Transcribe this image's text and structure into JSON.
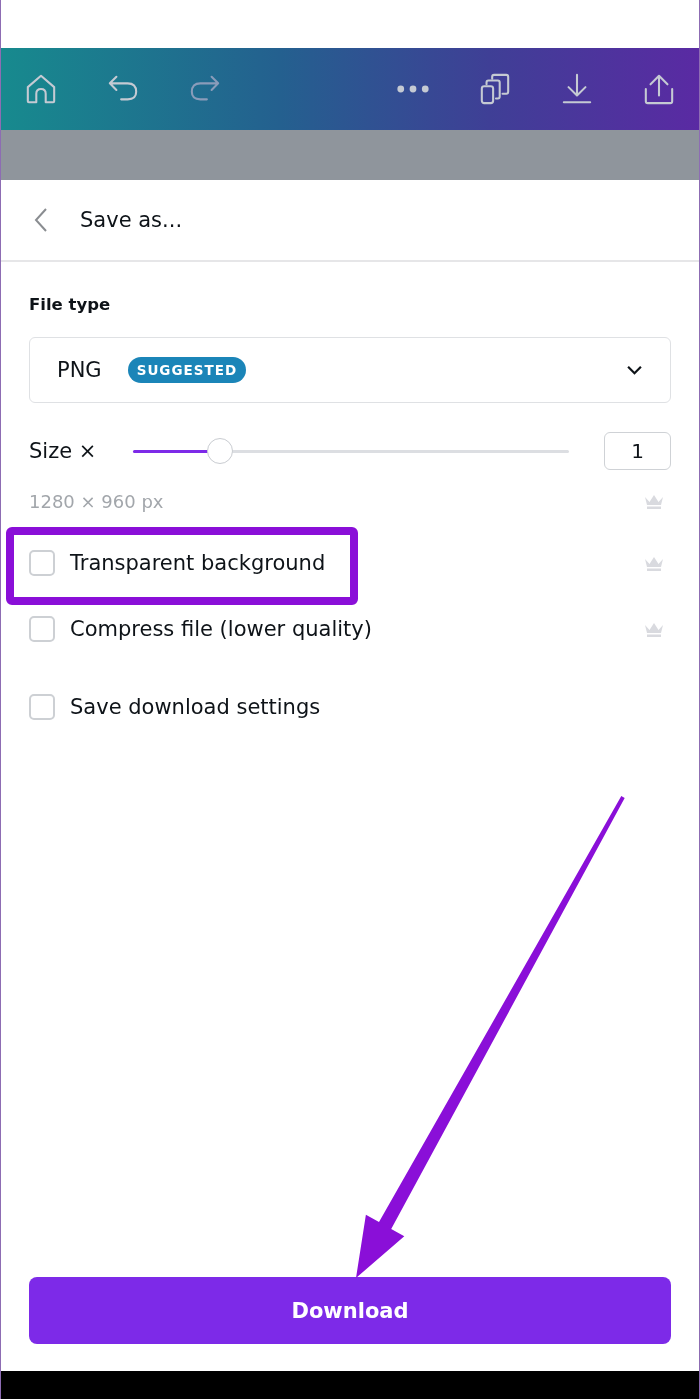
{
  "toolbar": [
    {
      "kind": "home",
      "disabled": false
    },
    {
      "kind": "undo",
      "disabled": false
    },
    {
      "kind": "redo",
      "disabled": true
    },
    {
      "kind": "more",
      "disabled": false
    },
    {
      "kind": "pages",
      "disabled": false
    },
    {
      "kind": "download",
      "disabled": false
    },
    {
      "kind": "share",
      "disabled": false
    }
  ],
  "panel": {
    "title": "Save as..."
  },
  "file_type": {
    "label": "File type",
    "value": "PNG",
    "badge": "SUGGESTED"
  },
  "size": {
    "label": "Size ×",
    "level": 0.2,
    "value": "1",
    "dimensions": "1280 × 960 px",
    "premium": true
  },
  "options": [
    {
      "label": "Transparent background",
      "checked": false,
      "premium": true,
      "highlighted": true
    },
    {
      "label": "Compress file (lower quality)",
      "checked": false,
      "premium": true,
      "highlighted": false
    },
    {
      "label": "Save download settings",
      "checked": false,
      "premium": false,
      "highlighted": false
    }
  ],
  "download_button": {
    "label": "Download",
    "annotated": true
  }
}
